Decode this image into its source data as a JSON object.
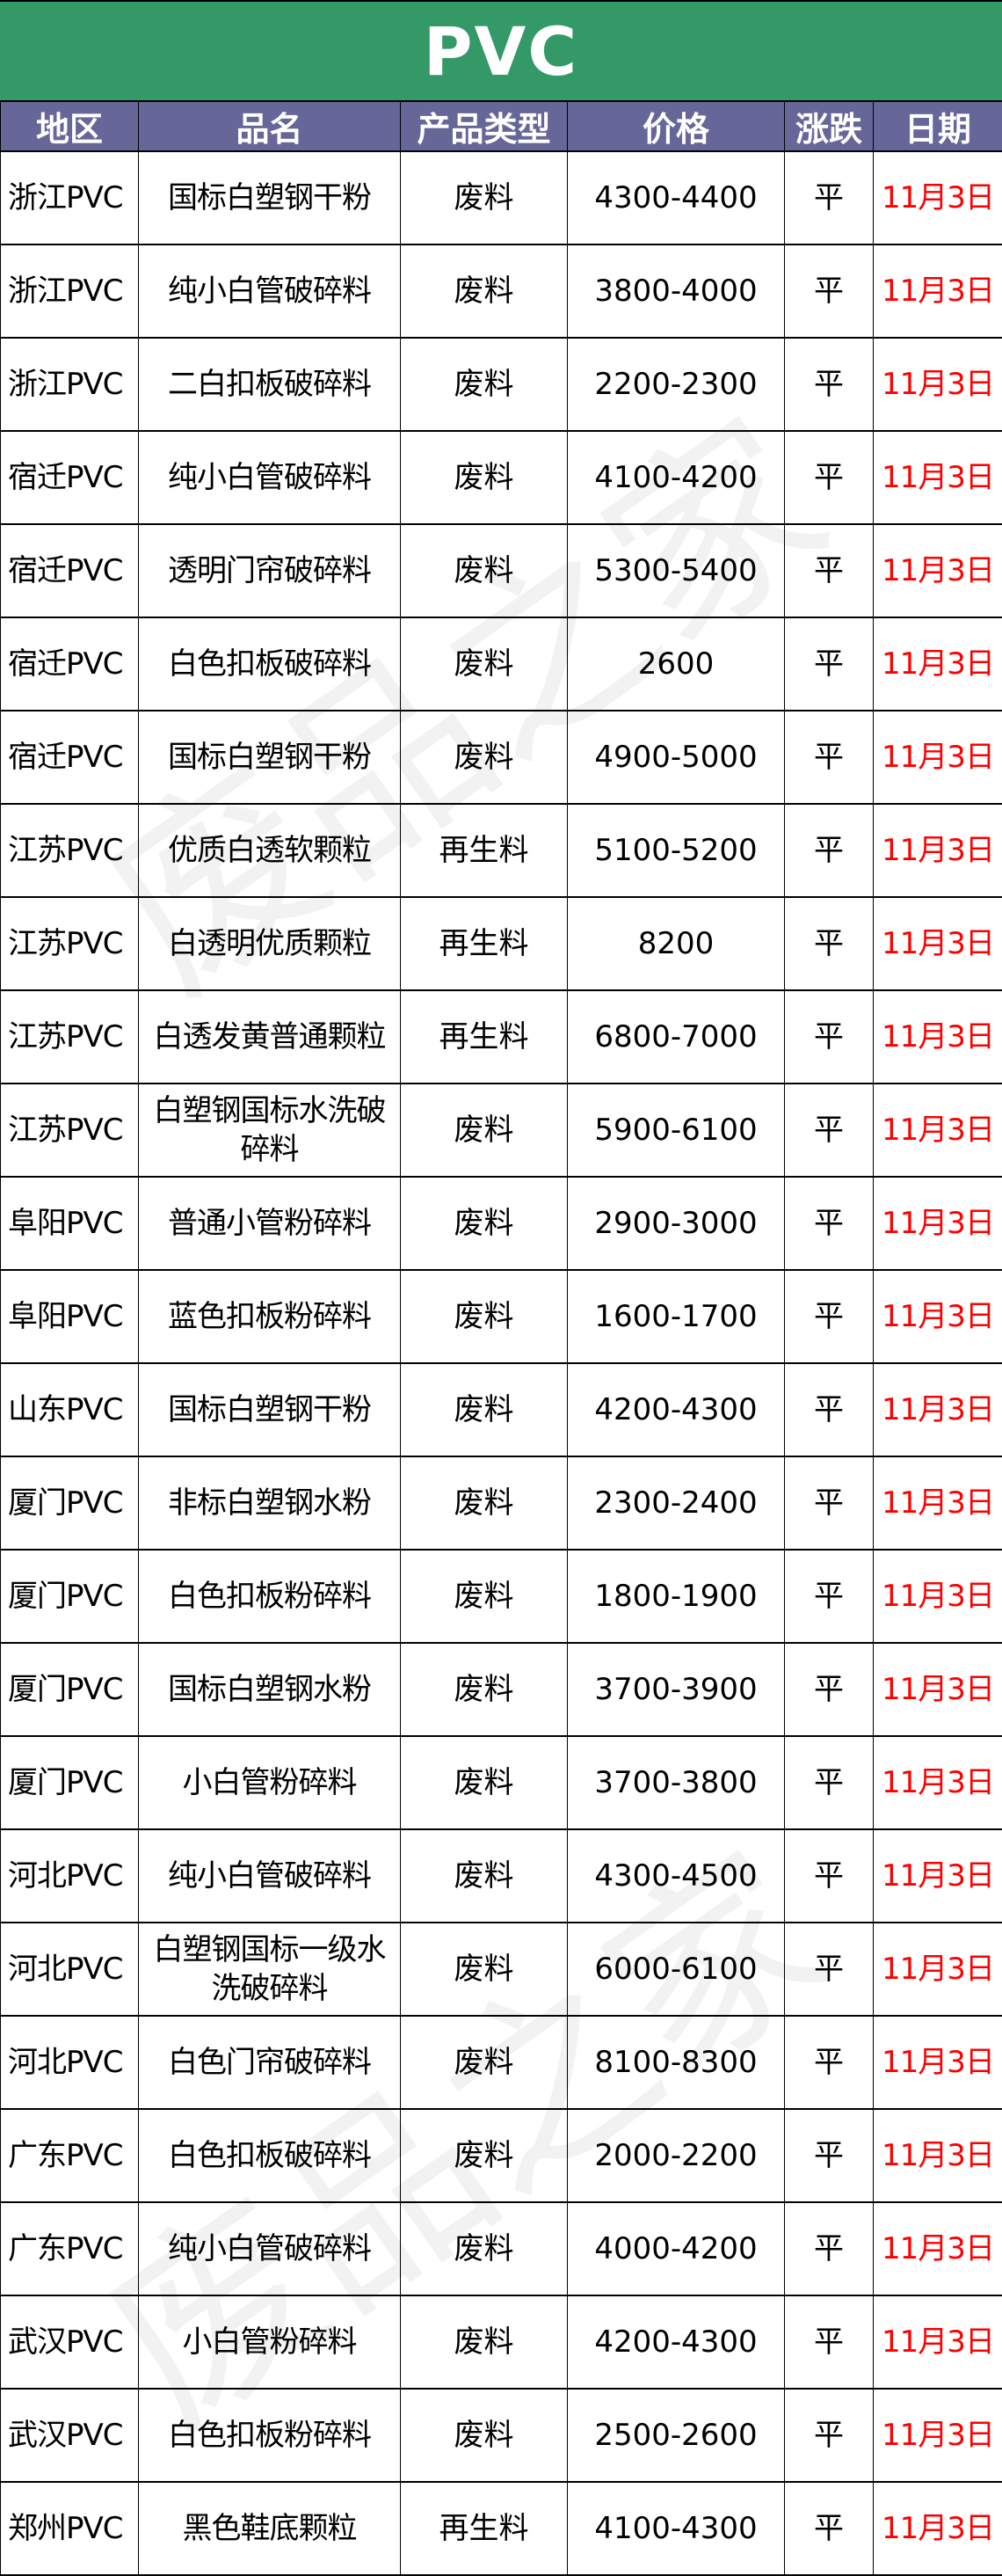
{
  "title": "PVC",
  "watermark": "废品之家",
  "colors": {
    "title_bg": "#339966",
    "header_bg": "#666699",
    "date_text": "#ff0000"
  },
  "headers": [
    "地区",
    "品名",
    "产品类型",
    "价格",
    "涨跌",
    "日期"
  ],
  "rows": [
    {
      "region": "浙江PVC",
      "product": "国标白塑钢干粉",
      "type": "废料",
      "price": "4300-4400",
      "change": "平",
      "date": "11月3日"
    },
    {
      "region": "浙江PVC",
      "product": "纯小白管破碎料",
      "type": "废料",
      "price": "3800-4000",
      "change": "平",
      "date": "11月3日"
    },
    {
      "region": "浙江PVC",
      "product": "二白扣板破碎料",
      "type": "废料",
      "price": "2200-2300",
      "change": "平",
      "date": "11月3日"
    },
    {
      "region": "宿迁PVC",
      "product": "纯小白管破碎料",
      "type": "废料",
      "price": "4100-4200",
      "change": "平",
      "date": "11月3日"
    },
    {
      "region": "宿迁PVC",
      "product": "透明门帘破碎料",
      "type": "废料",
      "price": "5300-5400",
      "change": "平",
      "date": "11月3日"
    },
    {
      "region": "宿迁PVC",
      "product": "白色扣板破碎料",
      "type": "废料",
      "price": "2600",
      "change": "平",
      "date": "11月3日"
    },
    {
      "region": "宿迁PVC",
      "product": "国标白塑钢干粉",
      "type": "废料",
      "price": "4900-5000",
      "change": "平",
      "date": "11月3日"
    },
    {
      "region": "江苏PVC",
      "product": "优质白透软颗粒",
      "type": "再生料",
      "price": "5100-5200",
      "change": "平",
      "date": "11月3日"
    },
    {
      "region": "江苏PVC",
      "product": "白透明优质颗粒",
      "type": "再生料",
      "price": "8200",
      "change": "平",
      "date": "11月3日"
    },
    {
      "region": "江苏PVC",
      "product": "白透发黄普通颗粒",
      "type": "再生料",
      "price": "6800-7000",
      "change": "平",
      "date": "11月3日"
    },
    {
      "region": "江苏PVC",
      "product": "白塑钢国标水洗破碎料",
      "type": "废料",
      "price": "5900-6100",
      "change": "平",
      "date": "11月3日"
    },
    {
      "region": "阜阳PVC",
      "product": "普通小管粉碎料",
      "type": "废料",
      "price": "2900-3000",
      "change": "平",
      "date": "11月3日"
    },
    {
      "region": "阜阳PVC",
      "product": "蓝色扣板粉碎料",
      "type": "废料",
      "price": "1600-1700",
      "change": "平",
      "date": "11月3日"
    },
    {
      "region": "山东PVC",
      "product": "国标白塑钢干粉",
      "type": "废料",
      "price": "4200-4300",
      "change": "平",
      "date": "11月3日"
    },
    {
      "region": "厦门PVC",
      "product": "非标白塑钢水粉",
      "type": "废料",
      "price": "2300-2400",
      "change": "平",
      "date": "11月3日"
    },
    {
      "region": "厦门PVC",
      "product": "白色扣板粉碎料",
      "type": "废料",
      "price": "1800-1900",
      "change": "平",
      "date": "11月3日"
    },
    {
      "region": "厦门PVC",
      "product": "国标白塑钢水粉",
      "type": "废料",
      "price": "3700-3900",
      "change": "平",
      "date": "11月3日"
    },
    {
      "region": "厦门PVC",
      "product": "小白管粉碎料",
      "type": "废料",
      "price": "3700-3800",
      "change": "平",
      "date": "11月3日"
    },
    {
      "region": "河北PVC",
      "product": "纯小白管破碎料",
      "type": "废料",
      "price": "4300-4500",
      "change": "平",
      "date": "11月3日"
    },
    {
      "region": "河北PVC",
      "product": "白塑钢国标一级水洗破碎料",
      "type": "废料",
      "price": "6000-6100",
      "change": "平",
      "date": "11月3日"
    },
    {
      "region": "河北PVC",
      "product": "白色门帘破碎料",
      "type": "废料",
      "price": "8100-8300",
      "change": "平",
      "date": "11月3日"
    },
    {
      "region": "广东PVC",
      "product": "白色扣板破碎料",
      "type": "废料",
      "price": "2000-2200",
      "change": "平",
      "date": "11月3日"
    },
    {
      "region": "广东PVC",
      "product": "纯小白管破碎料",
      "type": "废料",
      "price": "4000-4200",
      "change": "平",
      "date": "11月3日"
    },
    {
      "region": "武汉PVC",
      "product": "小白管粉碎料",
      "type": "废料",
      "price": "4200-4300",
      "change": "平",
      "date": "11月3日"
    },
    {
      "region": "武汉PVC",
      "product": "白色扣板粉碎料",
      "type": "废料",
      "price": "2500-2600",
      "change": "平",
      "date": "11月3日"
    },
    {
      "region": "郑州PVC",
      "product": "黑色鞋底颗粒",
      "type": "再生料",
      "price": "4100-4300",
      "change": "平",
      "date": "11月3日"
    }
  ]
}
